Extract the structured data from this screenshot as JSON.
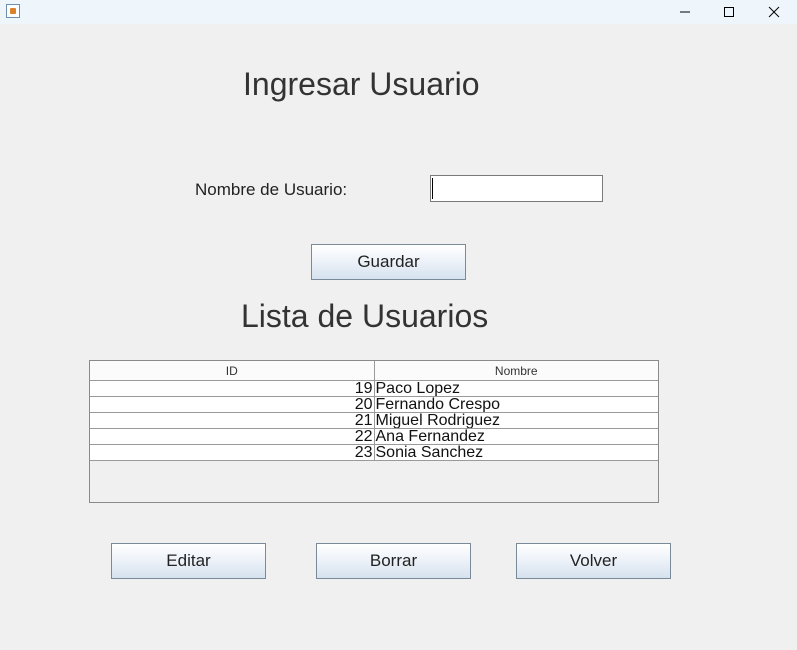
{
  "window": {
    "icon": "java-icon",
    "controls": {
      "minimize": "minimize-icon",
      "maximize": "maximize-icon",
      "close": "close-icon"
    }
  },
  "form": {
    "title": "Ingresar Usuario",
    "name_label": "Nombre de Usuario:",
    "name_value": "",
    "save_label": "Guardar"
  },
  "list": {
    "title": "Lista de Usuarios",
    "columns": [
      "ID",
      "Nombre"
    ],
    "rows": [
      {
        "id": "19",
        "name": "Paco Lopez"
      },
      {
        "id": "20",
        "name": "Fernando Crespo"
      },
      {
        "id": "21",
        "name": "Miguel Rodriguez"
      },
      {
        "id": "22",
        "name": "Ana Fernandez"
      },
      {
        "id": "23",
        "name": "Sonia Sanchez"
      }
    ]
  },
  "actions": {
    "edit_label": "Editar",
    "delete_label": "Borrar",
    "back_label": "Volver"
  }
}
